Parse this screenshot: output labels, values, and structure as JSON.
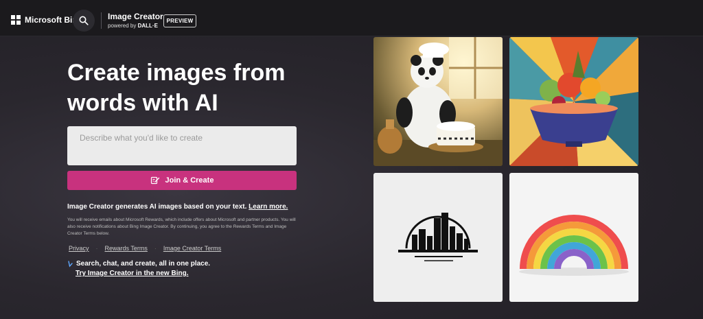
{
  "header": {
    "brand": "Microsoft Bing",
    "product_title": "Image Creator",
    "powered_by": "powered by",
    "powered_brand": "DALL·E",
    "badge": "PREVIEW"
  },
  "hero": {
    "title": "Create images from words with AI"
  },
  "prompt": {
    "placeholder": "Describe what you'd like to create"
  },
  "join_button": {
    "label": "Join & Create"
  },
  "info": {
    "text": "Image Creator generates AI images based on your text.",
    "learn_more": "Learn more."
  },
  "fine_print": "You will receive emails about Microsoft Rewards, which include offers about Microsoft and partner products. You will also receive notifications about Bing Image Creator. By continuing, you agree to the Rewards Terms and Image Creator Terms below.",
  "links": [
    "Privacy",
    "Rewards Terms",
    "Image Creator Terms"
  ],
  "promo": {
    "line1": "Search, chat, and create, all in one place.",
    "line2": "Try Image Creator in the new Bing."
  },
  "gallery": [
    {
      "name": "panda-chef-cake"
    },
    {
      "name": "fruit-bowl-geometric"
    },
    {
      "name": "city-skyline-circle"
    },
    {
      "name": "paper-rainbow"
    }
  ]
}
